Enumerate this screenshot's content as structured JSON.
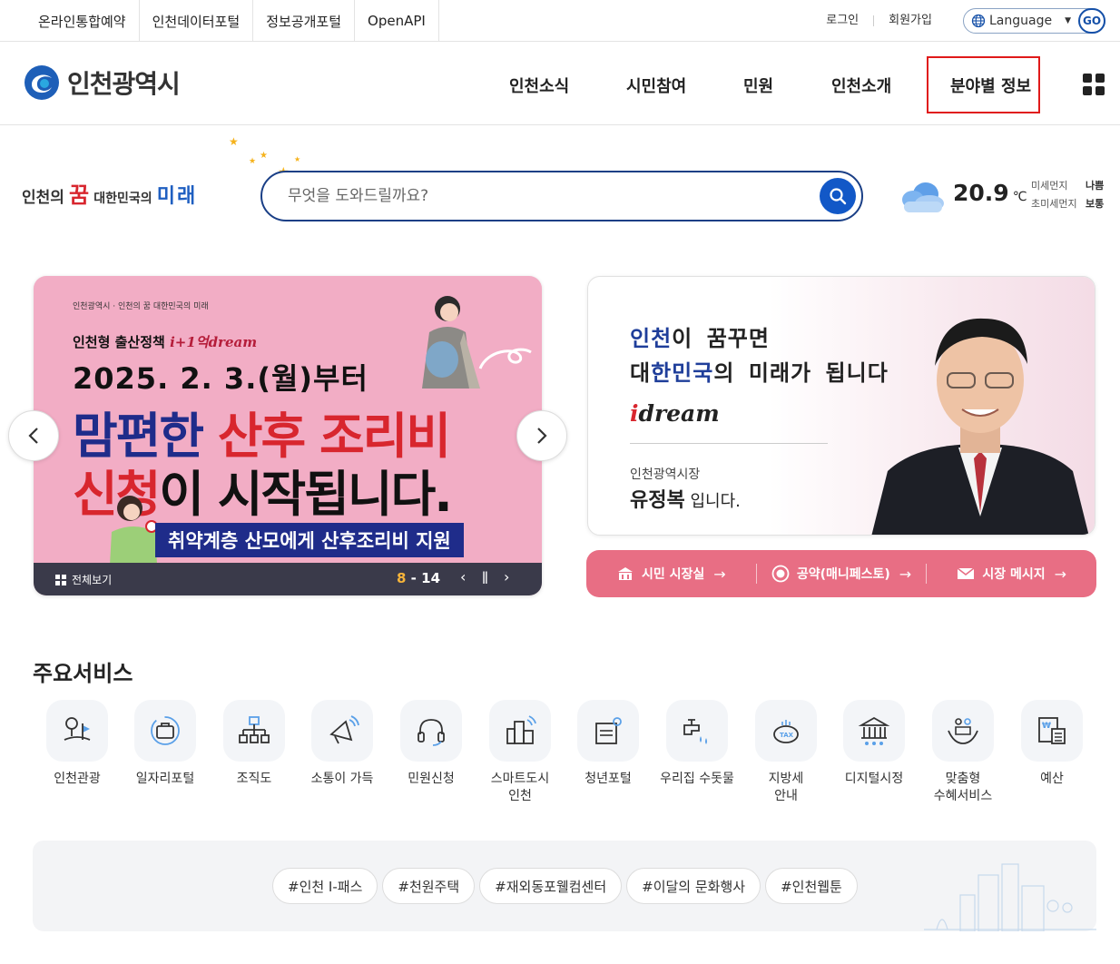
{
  "util_links": [
    "온라인통합예약",
    "인천데이터포털",
    "정보공개포털",
    "OpenAPI"
  ],
  "account": {
    "login": "로그인",
    "signup": "회원가입"
  },
  "language": {
    "label": "Language",
    "go": "GO"
  },
  "logo": {
    "text": "인천광역시"
  },
  "gnb": [
    "인천소식",
    "시민참여",
    "민원",
    "인천소개",
    "분야별 정보"
  ],
  "slogan": {
    "part1": "인천의",
    "part2": "꿈",
    "part3": "대한민국의",
    "part4": "미래"
  },
  "search": {
    "placeholder": "무엇을 도와드릴까요?"
  },
  "weather": {
    "temp": "20.9",
    "unit": "℃",
    "pm10_label": "미세먼지",
    "pm10_value": "나쁨",
    "pm25_label": "초미세먼지",
    "pm25_value": "보통"
  },
  "banner": {
    "mini": "인천광역시 · 인천의 꿈 대한민국의 미래",
    "policy": "인천형 출산정책",
    "policy_brand": "i+1억dream",
    "date": "2025. 2. 3.(월)부터",
    "line1_a": "맘편한 ",
    "line1_b": "산후 조리비",
    "line2_a": "신청",
    "line2_b": "이 시작됩니다.",
    "support": "취약계층 산모에게 산후조리비 지원",
    "view_all": "전체보기",
    "current": "8",
    "dash": "-",
    "total": "14",
    "prev_ctrl": "‹",
    "pause_ctrl": "ǁ",
    "next_ctrl": "›"
  },
  "mayor": {
    "q1_hl": "인천",
    "q1_rest": "이 꿈꾸면",
    "q2_a": "대",
    "q2_hl": "한민국",
    "q2_rest": "의 미래가 됩니다",
    "dream_i": "i",
    "dream_text": "dream",
    "role": "인천광역시장",
    "name": "유정복",
    "name_suffix": " 입니다."
  },
  "mayor_links": [
    "시민 시장실",
    "공약(매니페스토)",
    "시장 메시지"
  ],
  "services_title": "주요서비스",
  "services": [
    {
      "label": "인천관광",
      "icon": "tour-map-icon"
    },
    {
      "label": "일자리포털",
      "icon": "job-briefcase-icon"
    },
    {
      "label": "조직도",
      "icon": "org-chart-icon"
    },
    {
      "label": "소통이 가득",
      "icon": "megaphone-icon"
    },
    {
      "label": "민원신청",
      "icon": "headset-icon"
    },
    {
      "label": "스마트도시 인천",
      "line1": "스마트도시",
      "line2": "인천",
      "icon": "smart-city-icon"
    },
    {
      "label": "청년포털",
      "icon": "youth-portal-icon"
    },
    {
      "label": "우리집 수돗물",
      "icon": "water-tap-icon"
    },
    {
      "label": "지방세 안내",
      "line1": "지방세",
      "line2": "안내",
      "icon": "tax-piggy-icon"
    },
    {
      "label": "디지털시정",
      "icon": "digital-gov-icon"
    },
    {
      "label": "맞춤형 수혜서비스",
      "line1": "맞춤형",
      "line2": "수혜서비스",
      "icon": "welfare-hands-icon"
    },
    {
      "label": "예산",
      "icon": "budget-calculator-icon"
    }
  ],
  "hashtags": [
    "#인천 I-패스",
    "#천원주택",
    "#재외동포웰컴센터",
    "#이달의 문화행사",
    "#인천웹툰"
  ],
  "colors": {
    "navy": "#1a3f86",
    "blue": "#1258c7",
    "pink_banner": "#f2adc5",
    "mayor_links": "#e86e84",
    "highlight_red": "#e01a1a"
  }
}
